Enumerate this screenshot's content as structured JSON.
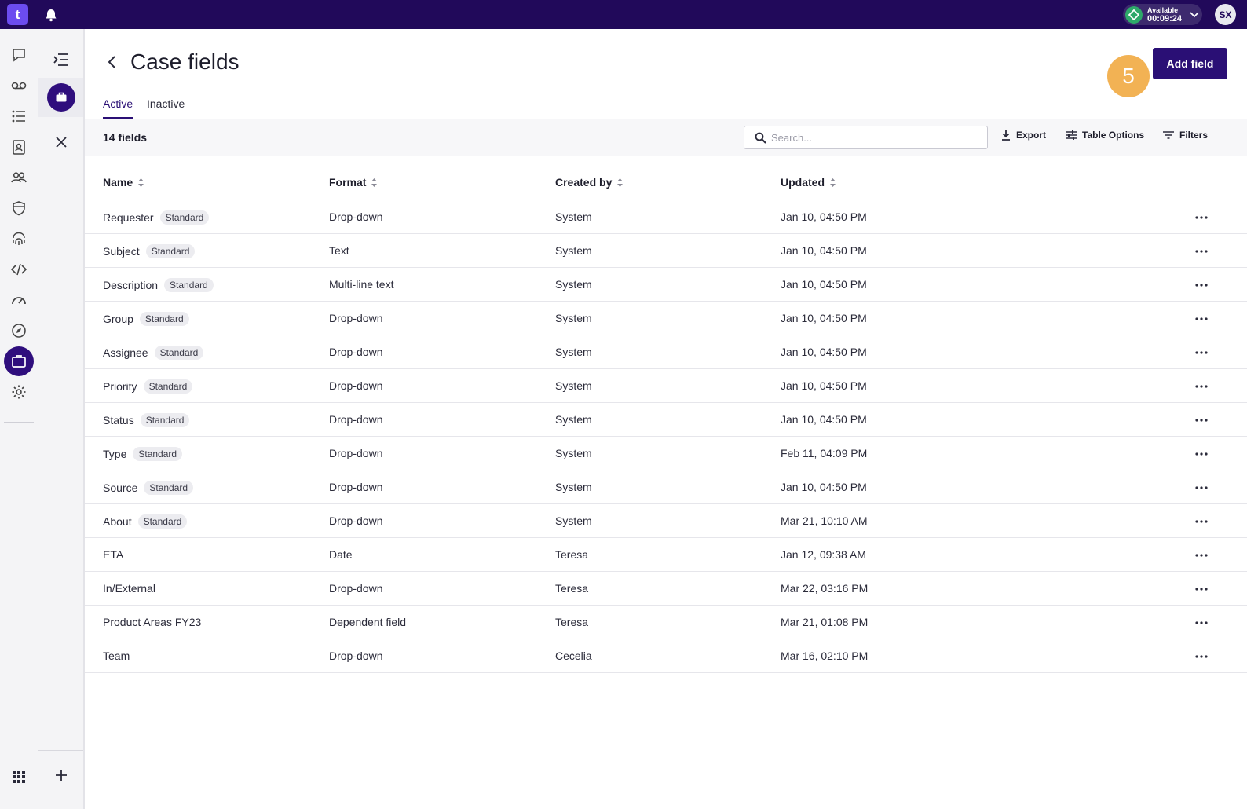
{
  "topbar": {
    "logo": "t",
    "status_label": "Available",
    "status_time": "00:09:24",
    "avatar": "SX"
  },
  "icons": {
    "rail": [
      "chat-icon",
      "voicemail-icon",
      "list-icon",
      "contacts-icon",
      "people-icon",
      "shield-icon",
      "fingerprint-icon",
      "code-icon",
      "speedometer-icon",
      "compass-icon",
      "briefcase-icon",
      "gear-icon"
    ],
    "apps": "apps-grid-icon"
  },
  "page": {
    "title": "Case fields",
    "add_button": "Add field",
    "step_badge": "5"
  },
  "tabs": [
    {
      "label": "Active",
      "active": true
    },
    {
      "label": "Inactive",
      "active": false
    }
  ],
  "toolbar": {
    "count": "14 fields",
    "search_placeholder": "Search...",
    "export": "Export",
    "table_options": "Table Options",
    "filters": "Filters"
  },
  "table": {
    "columns": [
      "Name",
      "Format",
      "Created by",
      "Updated"
    ],
    "rows": [
      {
        "name": "Requester",
        "badge": "Standard",
        "format": "Drop-down",
        "created_by": "System",
        "updated": "Jan 10, 04:50 PM"
      },
      {
        "name": "Subject",
        "badge": "Standard",
        "format": "Text",
        "created_by": "System",
        "updated": "Jan 10, 04:50 PM"
      },
      {
        "name": "Description",
        "badge": "Standard",
        "format": "Multi-line text",
        "created_by": "System",
        "updated": "Jan 10, 04:50 PM"
      },
      {
        "name": "Group",
        "badge": "Standard",
        "format": "Drop-down",
        "created_by": "System",
        "updated": "Jan 10, 04:50 PM"
      },
      {
        "name": "Assignee",
        "badge": "Standard",
        "format": "Drop-down",
        "created_by": "System",
        "updated": "Jan 10, 04:50 PM"
      },
      {
        "name": "Priority",
        "badge": "Standard",
        "format": "Drop-down",
        "created_by": "System",
        "updated": "Jan 10, 04:50 PM"
      },
      {
        "name": "Status",
        "badge": "Standard",
        "format": "Drop-down",
        "created_by": "System",
        "updated": "Jan 10, 04:50 PM"
      },
      {
        "name": "Type",
        "badge": "Standard",
        "format": "Drop-down",
        "created_by": "System",
        "updated": "Feb 11, 04:09 PM"
      },
      {
        "name": "Source",
        "badge": "Standard",
        "format": "Drop-down",
        "created_by": "System",
        "updated": "Jan 10, 04:50 PM"
      },
      {
        "name": "About",
        "badge": "Standard",
        "format": "Drop-down",
        "created_by": "System",
        "updated": "Mar 21, 10:10 AM"
      },
      {
        "name": "ETA",
        "badge": "",
        "format": "Date",
        "created_by": "Teresa",
        "updated": "Jan 12, 09:38 AM"
      },
      {
        "name": "In/External",
        "badge": "",
        "format": "Drop-down",
        "created_by": "Teresa",
        "updated": "Mar 22, 03:16 PM"
      },
      {
        "name": "Product Areas FY23",
        "badge": "",
        "format": "Dependent field",
        "created_by": "Teresa",
        "updated": "Mar 21, 01:08 PM"
      },
      {
        "name": "Team",
        "badge": "",
        "format": "Drop-down",
        "created_by": "Cecelia",
        "updated": "Mar 16, 02:10 PM"
      }
    ]
  }
}
